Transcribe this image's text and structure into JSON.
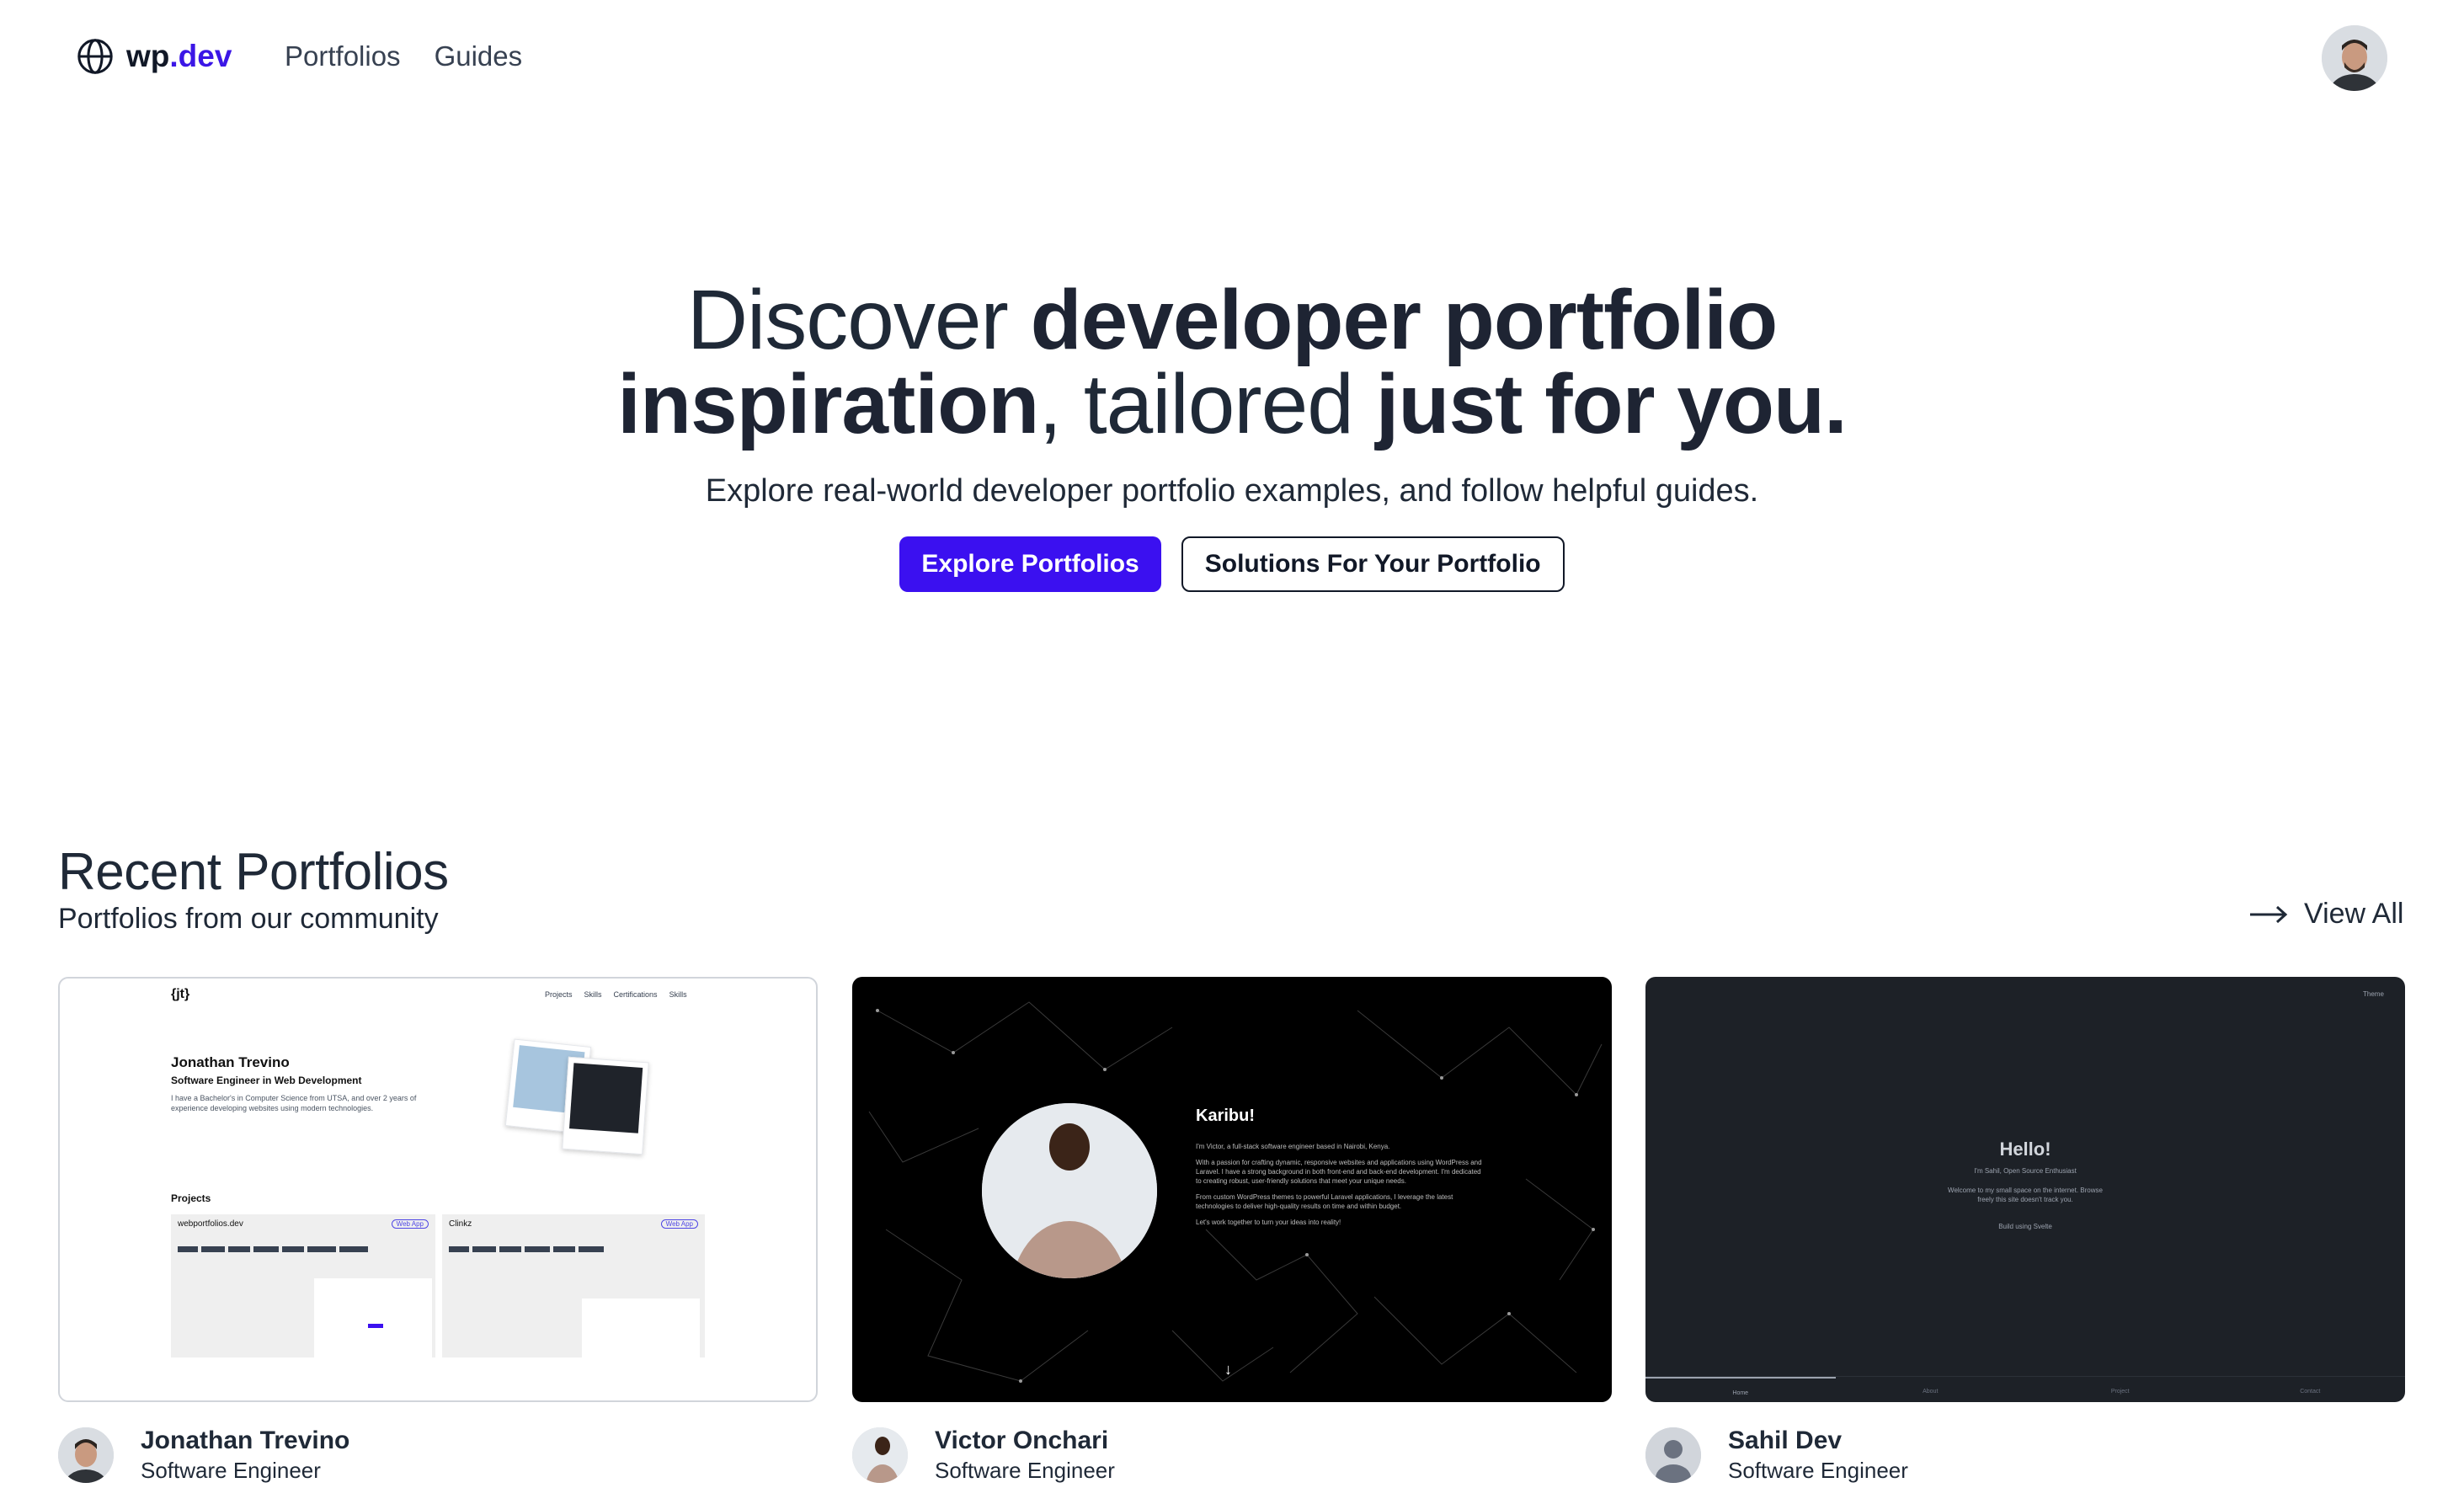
{
  "header": {
    "logo_prefix": "wp",
    "logo_accent": ".dev",
    "nav": [
      "Portfolios",
      "Guides"
    ]
  },
  "hero": {
    "line1_light": "Discover ",
    "line1_bold": "developer portfolio",
    "line2_bold1": "inspiration",
    "line2_light": ", tailored ",
    "line2_bold2": "just for you.",
    "subtitle": "Explore real-world developer portfolio examples, and follow helpful guides.",
    "primary_button": "Explore Portfolios",
    "secondary_button": "Solutions For Your Portfolio"
  },
  "recent": {
    "title": "Recent Portfolios",
    "subtitle": "Portfolios from our community",
    "view_all": "View All"
  },
  "cards": [
    {
      "name": "Jonathan Trevino",
      "role": "Software Engineer",
      "preview": {
        "logo": "{jt}",
        "nav": [
          "Projects",
          "Skills",
          "Certifications",
          "Skills"
        ],
        "heading": "Jonathan Trevino",
        "subheading": "Software Engineer in Web Development",
        "bio": "I have a Bachelor's in Computer Science from UTSA, and over 2 years of experience developing websites using modern technologies.",
        "projects_label": "Projects",
        "project1": "webportfolios.dev",
        "project2": "Clinkz",
        "badge": "Web App"
      }
    },
    {
      "name": "Victor Onchari",
      "role": "Software Engineer",
      "preview": {
        "heading": "Karibu!",
        "p1": "I'm Victor, a full-stack software engineer based in Nairobi, Kenya.",
        "p2": "With a passion for crafting dynamic, responsive websites and applications using WordPress and Laravel. I have a strong background in both front-end and back-end development. I'm dedicated to creating robust, user-friendly solutions that meet your unique needs.",
        "p3": "From custom WordPress themes to powerful Laravel applications, I leverage the latest technologies to deliver high-quality results on time and within budget.",
        "p4": "Let's work together to turn your ideas into reality!"
      }
    },
    {
      "name": "Sahil Dev",
      "role": "Software Engineer",
      "preview": {
        "theme": "Theme",
        "heading": "Hello!",
        "line1": "I'm Sahil, Open Source Enthusiast",
        "line2": "Welcome to my small space on the internet. Browse freely this site doesn't track you.",
        "line3": "Build using Svelte",
        "tabs": [
          "Home",
          "About",
          "Project",
          "Contact"
        ]
      }
    }
  ],
  "colors": {
    "accent": "#3b10f0",
    "text": "#1f2937",
    "card3_bg": "#1d2127"
  }
}
